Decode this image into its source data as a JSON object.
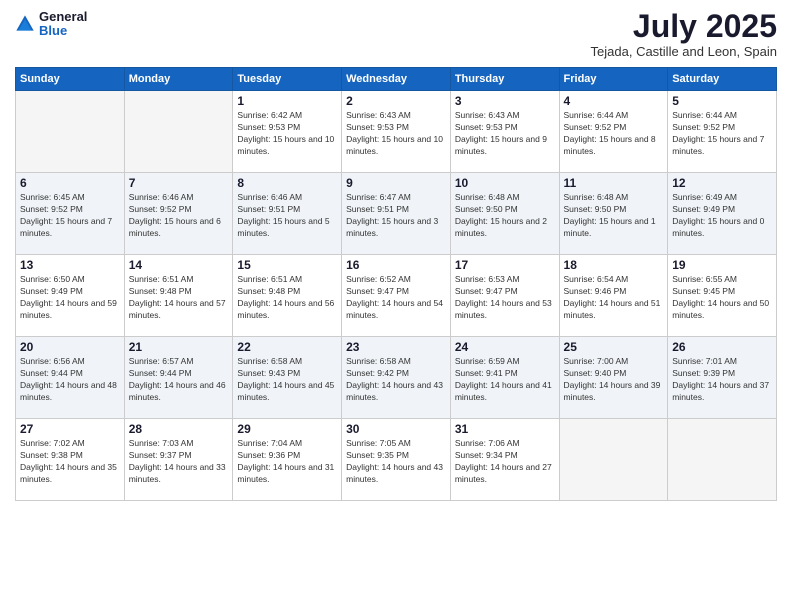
{
  "logo": {
    "general": "General",
    "blue": "Blue"
  },
  "title": "July 2025",
  "location": "Tejada, Castille and Leon, Spain",
  "weekdays": [
    "Sunday",
    "Monday",
    "Tuesday",
    "Wednesday",
    "Thursday",
    "Friday",
    "Saturday"
  ],
  "weeks": [
    [
      {
        "day": "",
        "sunrise": "",
        "sunset": "",
        "daylight": ""
      },
      {
        "day": "",
        "sunrise": "",
        "sunset": "",
        "daylight": ""
      },
      {
        "day": "1",
        "sunrise": "Sunrise: 6:42 AM",
        "sunset": "Sunset: 9:53 PM",
        "daylight": "Daylight: 15 hours and 10 minutes."
      },
      {
        "day": "2",
        "sunrise": "Sunrise: 6:43 AM",
        "sunset": "Sunset: 9:53 PM",
        "daylight": "Daylight: 15 hours and 10 minutes."
      },
      {
        "day": "3",
        "sunrise": "Sunrise: 6:43 AM",
        "sunset": "Sunset: 9:53 PM",
        "daylight": "Daylight: 15 hours and 9 minutes."
      },
      {
        "day": "4",
        "sunrise": "Sunrise: 6:44 AM",
        "sunset": "Sunset: 9:52 PM",
        "daylight": "Daylight: 15 hours and 8 minutes."
      },
      {
        "day": "5",
        "sunrise": "Sunrise: 6:44 AM",
        "sunset": "Sunset: 9:52 PM",
        "daylight": "Daylight: 15 hours and 7 minutes."
      }
    ],
    [
      {
        "day": "6",
        "sunrise": "Sunrise: 6:45 AM",
        "sunset": "Sunset: 9:52 PM",
        "daylight": "Daylight: 15 hours and 7 minutes."
      },
      {
        "day": "7",
        "sunrise": "Sunrise: 6:46 AM",
        "sunset": "Sunset: 9:52 PM",
        "daylight": "Daylight: 15 hours and 6 minutes."
      },
      {
        "day": "8",
        "sunrise": "Sunrise: 6:46 AM",
        "sunset": "Sunset: 9:51 PM",
        "daylight": "Daylight: 15 hours and 5 minutes."
      },
      {
        "day": "9",
        "sunrise": "Sunrise: 6:47 AM",
        "sunset": "Sunset: 9:51 PM",
        "daylight": "Daylight: 15 hours and 3 minutes."
      },
      {
        "day": "10",
        "sunrise": "Sunrise: 6:48 AM",
        "sunset": "Sunset: 9:50 PM",
        "daylight": "Daylight: 15 hours and 2 minutes."
      },
      {
        "day": "11",
        "sunrise": "Sunrise: 6:48 AM",
        "sunset": "Sunset: 9:50 PM",
        "daylight": "Daylight: 15 hours and 1 minute."
      },
      {
        "day": "12",
        "sunrise": "Sunrise: 6:49 AM",
        "sunset": "Sunset: 9:49 PM",
        "daylight": "Daylight: 15 hours and 0 minutes."
      }
    ],
    [
      {
        "day": "13",
        "sunrise": "Sunrise: 6:50 AM",
        "sunset": "Sunset: 9:49 PM",
        "daylight": "Daylight: 14 hours and 59 minutes."
      },
      {
        "day": "14",
        "sunrise": "Sunrise: 6:51 AM",
        "sunset": "Sunset: 9:48 PM",
        "daylight": "Daylight: 14 hours and 57 minutes."
      },
      {
        "day": "15",
        "sunrise": "Sunrise: 6:51 AM",
        "sunset": "Sunset: 9:48 PM",
        "daylight": "Daylight: 14 hours and 56 minutes."
      },
      {
        "day": "16",
        "sunrise": "Sunrise: 6:52 AM",
        "sunset": "Sunset: 9:47 PM",
        "daylight": "Daylight: 14 hours and 54 minutes."
      },
      {
        "day": "17",
        "sunrise": "Sunrise: 6:53 AM",
        "sunset": "Sunset: 9:47 PM",
        "daylight": "Daylight: 14 hours and 53 minutes."
      },
      {
        "day": "18",
        "sunrise": "Sunrise: 6:54 AM",
        "sunset": "Sunset: 9:46 PM",
        "daylight": "Daylight: 14 hours and 51 minutes."
      },
      {
        "day": "19",
        "sunrise": "Sunrise: 6:55 AM",
        "sunset": "Sunset: 9:45 PM",
        "daylight": "Daylight: 14 hours and 50 minutes."
      }
    ],
    [
      {
        "day": "20",
        "sunrise": "Sunrise: 6:56 AM",
        "sunset": "Sunset: 9:44 PM",
        "daylight": "Daylight: 14 hours and 48 minutes."
      },
      {
        "day": "21",
        "sunrise": "Sunrise: 6:57 AM",
        "sunset": "Sunset: 9:44 PM",
        "daylight": "Daylight: 14 hours and 46 minutes."
      },
      {
        "day": "22",
        "sunrise": "Sunrise: 6:58 AM",
        "sunset": "Sunset: 9:43 PM",
        "daylight": "Daylight: 14 hours and 45 minutes."
      },
      {
        "day": "23",
        "sunrise": "Sunrise: 6:58 AM",
        "sunset": "Sunset: 9:42 PM",
        "daylight": "Daylight: 14 hours and 43 minutes."
      },
      {
        "day": "24",
        "sunrise": "Sunrise: 6:59 AM",
        "sunset": "Sunset: 9:41 PM",
        "daylight": "Daylight: 14 hours and 41 minutes."
      },
      {
        "day": "25",
        "sunrise": "Sunrise: 7:00 AM",
        "sunset": "Sunset: 9:40 PM",
        "daylight": "Daylight: 14 hours and 39 minutes."
      },
      {
        "day": "26",
        "sunrise": "Sunrise: 7:01 AM",
        "sunset": "Sunset: 9:39 PM",
        "daylight": "Daylight: 14 hours and 37 minutes."
      }
    ],
    [
      {
        "day": "27",
        "sunrise": "Sunrise: 7:02 AM",
        "sunset": "Sunset: 9:38 PM",
        "daylight": "Daylight: 14 hours and 35 minutes."
      },
      {
        "day": "28",
        "sunrise": "Sunrise: 7:03 AM",
        "sunset": "Sunset: 9:37 PM",
        "daylight": "Daylight: 14 hours and 33 minutes."
      },
      {
        "day": "29",
        "sunrise": "Sunrise: 7:04 AM",
        "sunset": "Sunset: 9:36 PM",
        "daylight": "Daylight: 14 hours and 31 minutes."
      },
      {
        "day": "30",
        "sunrise": "Sunrise: 7:05 AM",
        "sunset": "Sunset: 9:35 PM",
        "daylight": "Daylight: 14 hours and 43 minutes."
      },
      {
        "day": "31",
        "sunrise": "Sunrise: 7:06 AM",
        "sunset": "Sunset: 9:34 PM",
        "daylight": "Daylight: 14 hours and 27 minutes."
      },
      {
        "day": "",
        "sunrise": "",
        "sunset": "",
        "daylight": ""
      },
      {
        "day": "",
        "sunrise": "",
        "sunset": "",
        "daylight": ""
      }
    ]
  ]
}
